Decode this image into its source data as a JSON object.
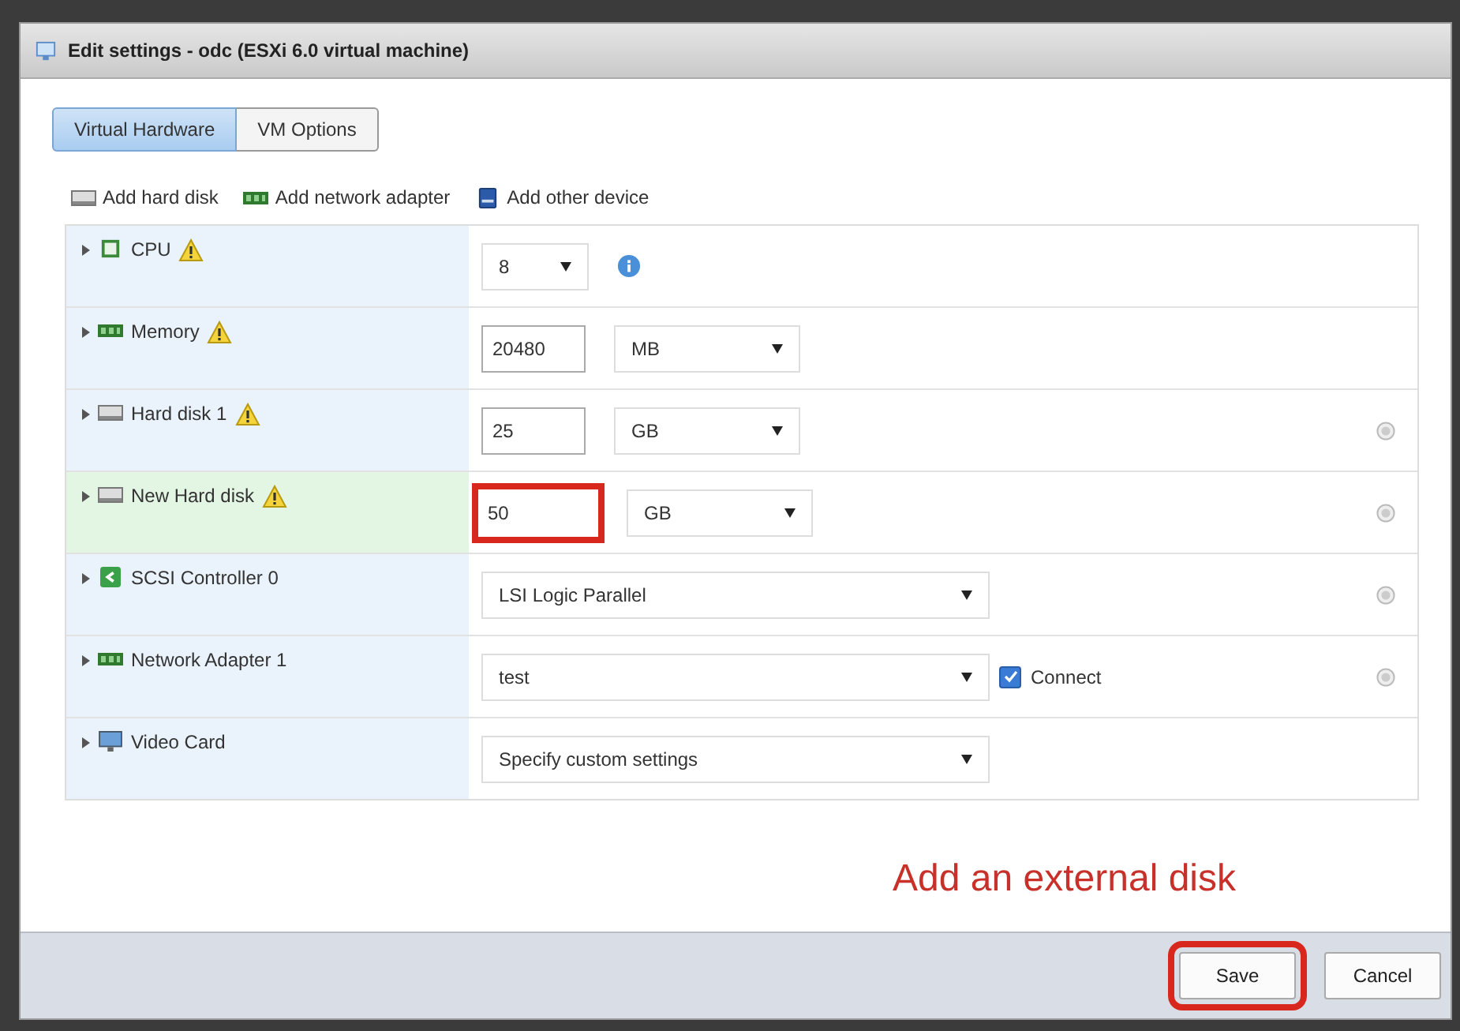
{
  "window": {
    "title": "Edit settings - odc (ESXi 6.0 virtual machine)"
  },
  "tabs": [
    {
      "label": "Virtual Hardware",
      "selected": true
    },
    {
      "label": "VM Options",
      "selected": false
    }
  ],
  "toolbar": [
    {
      "kind": "disk",
      "label": "Add hard disk"
    },
    {
      "kind": "network",
      "label": "Add network adapter"
    },
    {
      "kind": "device",
      "label": "Add other device"
    }
  ],
  "devices": [
    {
      "kind": "cpu",
      "label": "CPU",
      "warning": true,
      "selected": false,
      "removable": false,
      "control": {
        "kind": "select",
        "value": "8"
      },
      "info": true
    },
    {
      "kind": "memory",
      "label": "Memory",
      "warning": true,
      "selected": false,
      "removable": false,
      "control": {
        "kind": "input",
        "value": "20480"
      },
      "unit": "MB"
    },
    {
      "kind": "disk",
      "label": "Hard disk 1",
      "warning": true,
      "selected": false,
      "removable": true,
      "control": {
        "kind": "input",
        "value": "25"
      },
      "unit": "GB"
    },
    {
      "kind": "disk",
      "label": "New Hard disk",
      "warning": true,
      "selected": true,
      "removable": true,
      "control": {
        "kind": "input",
        "value": "50",
        "annotated": true
      },
      "unit": "GB"
    },
    {
      "kind": "controller",
      "label": "SCSI Controller 0",
      "warning": false,
      "selected": false,
      "removable": true,
      "control": {
        "kind": "wide",
        "value": "LSI Logic Parallel"
      }
    },
    {
      "kind": "network",
      "label": "Network Adapter 1",
      "warning": false,
      "selected": false,
      "removable": true,
      "control": {
        "kind": "wide",
        "value": "test"
      },
      "connect": {
        "label": "Connect",
        "checked": true
      }
    },
    {
      "kind": "video",
      "label": "Video Card",
      "warning": false,
      "selected": false,
      "removable": false,
      "control": {
        "kind": "wide",
        "value": "Specify custom settings"
      }
    }
  ],
  "annotation": "Add an external disk",
  "buttons": [
    {
      "label": "Save",
      "annotated": true
    },
    {
      "label": "Cancel",
      "annotated": false
    }
  ]
}
